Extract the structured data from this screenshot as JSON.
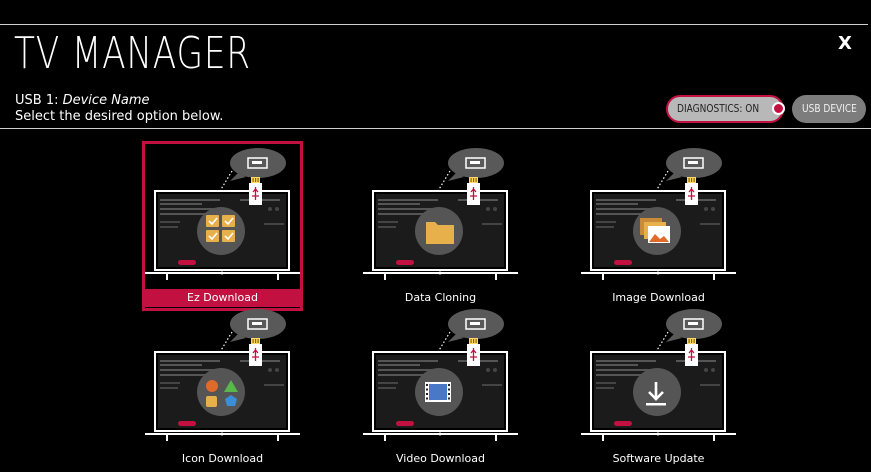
{
  "header": {
    "title": "TV MANAGER",
    "device_prefix": "USB 1: ",
    "device_name": "Device Name",
    "subtitle": "Select the desired option below.",
    "close_label": "X"
  },
  "toggles": {
    "diagnostics_label": "DIAGNOSTICS: ON",
    "usb_device_label": "USB DEVICE"
  },
  "colors": {
    "accent": "#c21140",
    "background": "#000000",
    "folder": "#e8b04a"
  },
  "options": [
    {
      "label": "Ez Download",
      "icon": "checkbox-grid-icon",
      "selected": true
    },
    {
      "label": "Data Cloning",
      "icon": "folder-icon",
      "selected": false
    },
    {
      "label": "Image Download",
      "icon": "image-stack-icon",
      "selected": false
    },
    {
      "label": "Icon Download",
      "icon": "shapes-icon",
      "selected": false
    },
    {
      "label": "Video Download",
      "icon": "film-icon",
      "selected": false
    },
    {
      "label": "Software Update",
      "icon": "download-arrow-icon",
      "selected": false
    }
  ]
}
